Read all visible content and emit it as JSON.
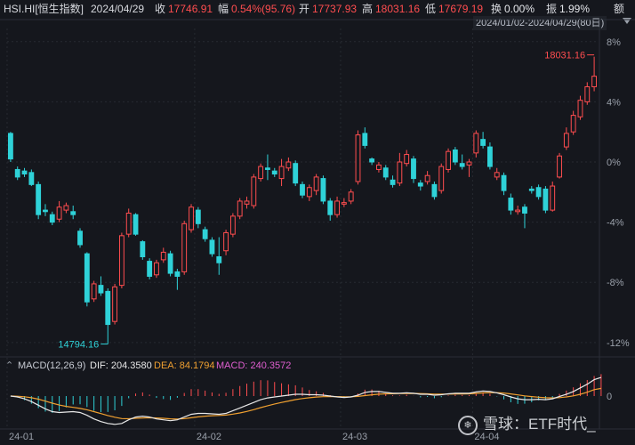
{
  "header": {
    "symbol": "HSI.HI[恒生指数]",
    "date": "2024/04/29",
    "close_label": "收",
    "close_value": "17746.91",
    "change_label": "幅",
    "change_value": "0.54%(95.76)",
    "open_label": "开",
    "open_value": "17737.93",
    "high_label": "高",
    "high_value": "18031.16",
    "low_label": "低",
    "low_value": "17679.19",
    "turnover_label": "换",
    "turnover_value": "0.00%",
    "amplitude_label": "振",
    "amplitude_value": "1.99%",
    "amount_label": "额"
  },
  "range_label": "2024/01/02-2024/04/29(80日)",
  "macd": {
    "label": "MACD(12,26,9)",
    "dif_label": "DIF: 204.3580",
    "dea_label": "DEA: 84.1794",
    "macd_label": "MACD: 240.3572",
    "zero_tick": "0",
    "colors": {
      "dif": "#e8e8e8",
      "dea": "#f0a030",
      "pos": "#ff4d4f",
      "neg": "#2fd2d8"
    }
  },
  "watermark": {
    "icon": "snowball-logo-icon",
    "text": "雪球：ETF时代_"
  },
  "chart_data": {
    "type": "candlestick",
    "y_axis": {
      "ticks": [
        "8%",
        "4%",
        "0%",
        "-4%",
        "-8%",
        "-12%"
      ],
      "tick_values": [
        8,
        4,
        0,
        -4,
        -8,
        -12
      ],
      "range": [
        -12.6,
        8.4
      ],
      "unit": "% change from first close"
    },
    "x_axis": {
      "tick_labels": [
        "24-01",
        "24-02",
        "24-03",
        "24-04"
      ],
      "tick_index": [
        0,
        27,
        48,
        67
      ]
    },
    "annotations": [
      {
        "text": "18031.16",
        "kind": "max",
        "value": 7.1
      },
      {
        "text": "14794.16",
        "kind": "min",
        "value": -12.1
      }
    ],
    "colors": {
      "up": "#ff4d4f",
      "down": "#2fd2d8"
    },
    "candles": [
      [
        1.9,
        0.2,
        2.0,
        0.0
      ],
      [
        -0.5,
        -1.0,
        -0.3,
        -1.2
      ],
      [
        -0.6,
        -0.8,
        -0.4,
        -1.0
      ],
      [
        -0.7,
        -1.5,
        -0.5,
        -1.6
      ],
      [
        -1.5,
        -3.5,
        -1.3,
        -3.8
      ],
      [
        -3.2,
        -3.3,
        -2.8,
        -3.6
      ],
      [
        -3.5,
        -4.0,
        -3.3,
        -4.2
      ],
      [
        -3.8,
        -3.0,
        -2.6,
        -4.0
      ],
      [
        -3.2,
        -2.9,
        -2.7,
        -3.4
      ],
      [
        -3.3,
        -3.5,
        -2.9,
        -3.8
      ],
      [
        -4.6,
        -5.5,
        -4.4,
        -5.7
      ],
      [
        -6.1,
        -9.3,
        -6.0,
        -9.6
      ],
      [
        -9.1,
        -8.1,
        -7.9,
        -9.3
      ],
      [
        -8.2,
        -8.7,
        -7.6,
        -8.9
      ],
      [
        -8.6,
        -10.8,
        -8.4,
        -12.1
      ],
      [
        -10.6,
        -8.3,
        -8.1,
        -10.8
      ],
      [
        -8.2,
        -4.9,
        -4.7,
        -8.4
      ],
      [
        -4.8,
        -3.4,
        -3.1,
        -5.0
      ],
      [
        -3.5,
        -4.8,
        -3.4,
        -4.9
      ],
      [
        -5.3,
        -6.3,
        -5.2,
        -6.5
      ],
      [
        -6.6,
        -7.6,
        -6.4,
        -7.8
      ],
      [
        -7.5,
        -6.7,
        -6.5,
        -7.7
      ],
      [
        -6.5,
        -6.0,
        -5.7,
        -6.7
      ],
      [
        -6.1,
        -7.4,
        -5.9,
        -7.6
      ],
      [
        -7.3,
        -7.6,
        -7.1,
        -8.5
      ],
      [
        -7.3,
        -4.1,
        -3.9,
        -7.5
      ],
      [
        -4.5,
        -3.0,
        -2.8,
        -4.7
      ],
      [
        -3.2,
        -4.1,
        -3.0,
        -4.4
      ],
      [
        -4.5,
        -5.1,
        -4.3,
        -5.3
      ],
      [
        -5.2,
        -6.1,
        -5.0,
        -6.3
      ],
      [
        -6.3,
        -6.7,
        -5.0,
        -7.5
      ],
      [
        -5.9,
        -4.7,
        -4.5,
        -6.2
      ],
      [
        -4.8,
        -3.6,
        -3.4,
        -5.0
      ],
      [
        -3.6,
        -2.6,
        -2.4,
        -3.8
      ],
      [
        -2.8,
        -2.6,
        -2.3,
        -3.1
      ],
      [
        -2.9,
        -1.0,
        -0.8,
        -3.1
      ],
      [
        -1.1,
        -0.3,
        -0.1,
        -1.3
      ],
      [
        -0.4,
        -0.5,
        0.5,
        -1.2
      ],
      [
        -0.6,
        -0.8,
        -0.4,
        -1.0
      ],
      [
        -1.1,
        -0.3,
        0.2,
        -1.6
      ],
      [
        -0.4,
        0.0,
        0.3,
        -0.6
      ],
      [
        -0.1,
        -1.4,
        0.1,
        -1.6
      ],
      [
        -1.5,
        -2.2,
        -1.3,
        -2.4
      ],
      [
        -2.3,
        -1.7,
        -1.5,
        -2.6
      ],
      [
        -1.9,
        -1.0,
        -0.8,
        -2.2
      ],
      [
        -1.1,
        -2.6,
        -0.9,
        -2.8
      ],
      [
        -2.6,
        -3.5,
        -2.4,
        -3.9
      ],
      [
        -3.5,
        -2.6,
        -2.3,
        -3.7
      ],
      [
        -2.8,
        -2.7,
        -2.4,
        -3.0
      ],
      [
        -2.6,
        -2.0,
        -1.8,
        -2.8
      ],
      [
        -1.3,
        1.8,
        2.1,
        -1.5
      ],
      [
        1.9,
        1.1,
        2.3,
        0.9
      ],
      [
        0.2,
        0.0,
        0.3,
        -0.2
      ],
      [
        -0.5,
        -0.2,
        0.0,
        -0.7
      ],
      [
        -0.4,
        -1.0,
        -0.2,
        -1.2
      ],
      [
        -1.2,
        -1.5,
        -0.9,
        -1.7
      ],
      [
        -1.4,
        0.0,
        0.6,
        -1.6
      ],
      [
        -0.1,
        0.5,
        0.8,
        -0.3
      ],
      [
        0.2,
        -1.1,
        0.4,
        -1.4
      ],
      [
        -1.4,
        -1.6,
        -1.2,
        -1.9
      ],
      [
        -1.3,
        -0.9,
        -0.6,
        -1.5
      ],
      [
        -1.5,
        -2.3,
        -1.3,
        -2.5
      ],
      [
        -1.9,
        -0.3,
        -0.1,
        -2.1
      ],
      [
        -0.5,
        0.7,
        0.9,
        -0.7
      ],
      [
        0.8,
        0.0,
        1.0,
        -0.2
      ],
      [
        -0.1,
        -0.3,
        0.5,
        -0.5
      ],
      [
        -0.2,
        0.0,
        0.2,
        -1.0
      ],
      [
        0.6,
        1.9,
        2.1,
        0.3
      ],
      [
        1.5,
        1.1,
        2.0,
        0.9
      ],
      [
        1.0,
        -0.3,
        1.3,
        -0.5
      ],
      [
        -1.0,
        -0.7,
        -0.4,
        -1.2
      ],
      [
        -0.9,
        -1.9,
        -0.7,
        -2.2
      ],
      [
        -2.4,
        -3.2,
        -2.1,
        -3.5
      ],
      [
        -3.3,
        -3.2,
        -2.9,
        -3.5
      ],
      [
        -3.0,
        -3.4,
        -2.8,
        -4.4
      ],
      [
        -1.8,
        -1.9,
        -1.6,
        -2.1
      ],
      [
        -1.7,
        -2.3,
        -1.5,
        -2.5
      ],
      [
        -1.8,
        -3.2,
        -1.6,
        -3.4
      ],
      [
        -3.2,
        -1.6,
        -1.3,
        -3.3
      ],
      [
        -1.0,
        0.4,
        0.6,
        -1.1
      ],
      [
        1.0,
        1.9,
        2.3,
        0.8
      ],
      [
        2.0,
        3.1,
        3.4,
        1.8
      ],
      [
        3.0,
        4.1,
        4.4,
        2.8
      ],
      [
        4.0,
        5.0,
        5.3,
        3.8
      ],
      [
        5.0,
        5.7,
        7.0,
        4.7
      ]
    ],
    "macd_series": {
      "dif": [
        0,
        -10,
        -30,
        -60,
        -100,
        -140,
        -170,
        -180,
        -175,
        -170,
        -180,
        -210,
        -250,
        -280,
        -300,
        -310,
        -300,
        -260,
        -230,
        -220,
        -230,
        -250,
        -260,
        -270,
        -260,
        -230,
        -200,
        -190,
        -190,
        -195,
        -200,
        -190,
        -160,
        -130,
        -100,
        -70,
        -40,
        -20,
        -10,
        0,
        10,
        20,
        20,
        15,
        15,
        10,
        0,
        -10,
        -15,
        -10,
        10,
        40,
        50,
        50,
        40,
        30,
        30,
        35,
        30,
        20,
        20,
        10,
        15,
        25,
        30,
        30,
        30,
        45,
        55,
        50,
        35,
        15,
        -10,
        -30,
        -40,
        -40,
        -35,
        -40,
        -30,
        -5,
        20,
        50,
        90,
        130,
        180,
        204
      ],
      "dea": [
        0,
        -2,
        -8,
        -18,
        -34,
        -55,
        -78,
        -98,
        -113,
        -124,
        -135,
        -150,
        -170,
        -192,
        -213,
        -232,
        -246,
        -248,
        -244,
        -240,
        -238,
        -240,
        -244,
        -249,
        -251,
        -247,
        -238,
        -228,
        -220,
        -215,
        -212,
        -208,
        -198,
        -185,
        -168,
        -149,
        -127,
        -106,
        -87,
        -70,
        -54,
        -39,
        -27,
        -18,
        -11,
        -7,
        -5,
        -6,
        -8,
        -8,
        -4,
        5,
        14,
        21,
        25,
        26,
        27,
        28,
        29,
        27,
        25,
        22,
        21,
        22,
        23,
        24,
        25,
        29,
        34,
        37,
        37,
        33,
        24,
        13,
        2,
        -6,
        -12,
        -18,
        -20,
        -17,
        -10,
        2,
        20,
        42,
        70,
        84
      ]
    }
  }
}
